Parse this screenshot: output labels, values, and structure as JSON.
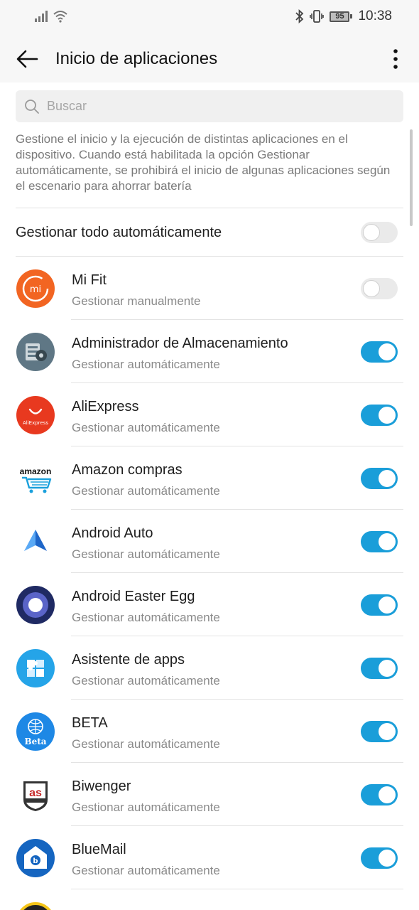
{
  "status_bar": {
    "time": "10:38",
    "battery_level": "95"
  },
  "header": {
    "title": "Inicio de aplicaciones"
  },
  "search": {
    "placeholder": "Buscar"
  },
  "description": "Gestione el inicio y la ejecución de distintas aplicaciones en el dispositivo. Cuando está habilitada la opción Gestionar automáticamente, se prohibirá el inicio de algunas aplicaciones según el escenario para ahorrar batería",
  "global": {
    "label": "Gestionar todo automáticamente",
    "enabled": false
  },
  "apps": [
    {
      "name": "Mi Fit",
      "status": "Gestionar manualmente",
      "enabled": false,
      "icon": "mi-fit-icon",
      "color": "#f26522"
    },
    {
      "name": "Administrador de Almacenamiento",
      "status": "Gestionar automáticamente",
      "enabled": true,
      "icon": "storage-manager-icon",
      "color": "#5f7785"
    },
    {
      "name": "AliExpress",
      "status": "Gestionar automáticamente",
      "enabled": true,
      "icon": "aliexpress-icon",
      "color": "#e8391f",
      "icon_text": "AliExpress"
    },
    {
      "name": "Amazon compras",
      "status": "Gestionar automáticamente",
      "enabled": true,
      "icon": "amazon-icon",
      "color": "#1aa0dc",
      "icon_text": "amazon"
    },
    {
      "name": "Android Auto",
      "status": "Gestionar automáticamente",
      "enabled": true,
      "icon": "android-auto-icon",
      "color": "#4285f4"
    },
    {
      "name": "Android Easter Egg",
      "status": "Gestionar automáticamente",
      "enabled": true,
      "icon": "easter-egg-icon",
      "color": "#1f2a63"
    },
    {
      "name": "Asistente de apps",
      "status": "Gestionar automáticamente",
      "enabled": true,
      "icon": "puzzle-icon",
      "color": "#25a4e8"
    },
    {
      "name": "BETA",
      "status": "Gestionar automáticamente",
      "enabled": true,
      "icon": "beta-icon",
      "color": "#1e88e5",
      "icon_text": "Beta"
    },
    {
      "name": "Biwenger",
      "status": "Gestionar automáticamente",
      "enabled": true,
      "icon": "biwenger-icon",
      "color": "#c62828",
      "icon_text": "as"
    },
    {
      "name": "BlueMail",
      "status": "Gestionar automáticamente",
      "enabled": true,
      "icon": "bluemail-icon",
      "color": "#1565c0"
    }
  ],
  "colors": {
    "accent": "#1a9ed9",
    "toggle_off": "#eaeaea"
  }
}
